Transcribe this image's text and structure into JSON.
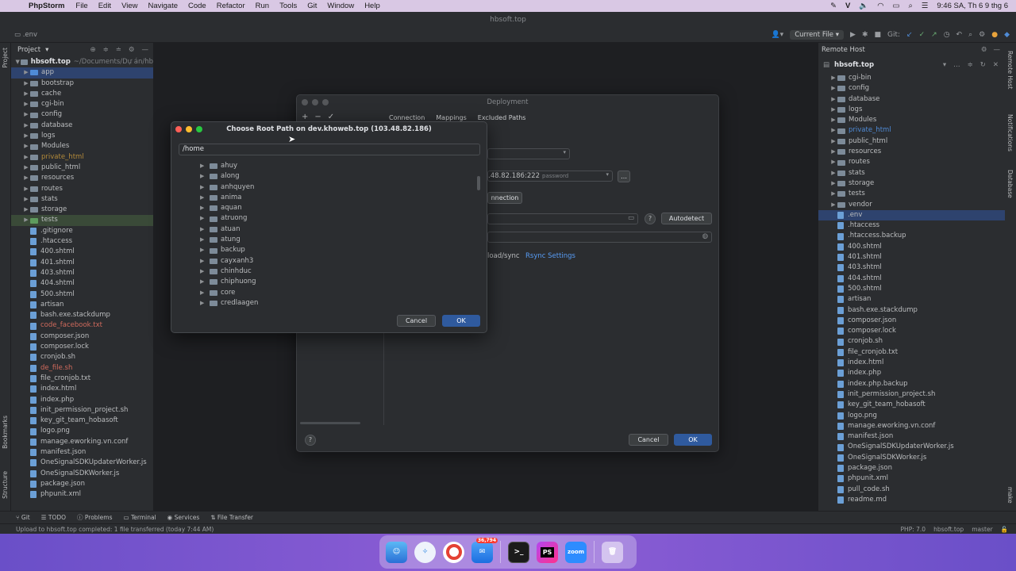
{
  "menubar": {
    "app_name": "PhpStorm",
    "items": [
      "File",
      "Edit",
      "View",
      "Navigate",
      "Code",
      "Refactor",
      "Run",
      "Tools",
      "Git",
      "Window",
      "Help"
    ],
    "clock": "9:46 SA, Th 6 9 thg 6"
  },
  "window": {
    "title": "hbsoft.top"
  },
  "toolbar": {
    "breadcrumb": ".env",
    "run_config": "Current File",
    "git_label": "Git:"
  },
  "left_stripe": {
    "project": "Project",
    "bookmarks": "Bookmarks",
    "structure": "Structure"
  },
  "project_panel": {
    "title": "Project",
    "root": "hbsoft.top",
    "root_path": "~/Documents/Dự án/hb",
    "items": [
      {
        "name": "app",
        "kind": "folder",
        "color": "blue",
        "state": "selected"
      },
      {
        "name": "bootstrap",
        "kind": "folder"
      },
      {
        "name": "cache",
        "kind": "folder"
      },
      {
        "name": "cgi-bin",
        "kind": "folder"
      },
      {
        "name": "config",
        "kind": "folder"
      },
      {
        "name": "database",
        "kind": "folder"
      },
      {
        "name": "logs",
        "kind": "folder"
      },
      {
        "name": "Modules",
        "kind": "folder"
      },
      {
        "name": "private_html",
        "kind": "folder",
        "text": "orange"
      },
      {
        "name": "public_html",
        "kind": "folder"
      },
      {
        "name": "resources",
        "kind": "folder"
      },
      {
        "name": "routes",
        "kind": "folder"
      },
      {
        "name": "stats",
        "kind": "folder"
      },
      {
        "name": "storage",
        "kind": "folder"
      },
      {
        "name": "tests",
        "kind": "folder",
        "color": "green",
        "state": "highlight"
      },
      {
        "name": ".gitignore",
        "kind": "file"
      },
      {
        "name": ".htaccess",
        "kind": "file"
      },
      {
        "name": "400.shtml",
        "kind": "file"
      },
      {
        "name": "401.shtml",
        "kind": "file"
      },
      {
        "name": "403.shtml",
        "kind": "file"
      },
      {
        "name": "404.shtml",
        "kind": "file"
      },
      {
        "name": "500.shtml",
        "kind": "file"
      },
      {
        "name": "artisan",
        "kind": "file"
      },
      {
        "name": "bash.exe.stackdump",
        "kind": "file"
      },
      {
        "name": "code_facebook.txt",
        "kind": "file",
        "text": "red"
      },
      {
        "name": "composer.json",
        "kind": "file"
      },
      {
        "name": "composer.lock",
        "kind": "file"
      },
      {
        "name": "cronjob.sh",
        "kind": "file"
      },
      {
        "name": "de_file.sh",
        "kind": "file",
        "text": "red"
      },
      {
        "name": "file_cronjob.txt",
        "kind": "file"
      },
      {
        "name": "index.html",
        "kind": "file"
      },
      {
        "name": "index.php",
        "kind": "file"
      },
      {
        "name": "init_permission_project.sh",
        "kind": "file"
      },
      {
        "name": "key_git_team_hobasoft",
        "kind": "file"
      },
      {
        "name": "logo.png",
        "kind": "file"
      },
      {
        "name": "manage.eworking.vn.conf",
        "kind": "file"
      },
      {
        "name": "manifest.json",
        "kind": "file"
      },
      {
        "name": "OneSignalSDKUpdaterWorker.js",
        "kind": "file"
      },
      {
        "name": "OneSignalSDKWorker.js",
        "kind": "file"
      },
      {
        "name": "package.json",
        "kind": "file"
      },
      {
        "name": "phpunit.xml",
        "kind": "file"
      }
    ]
  },
  "deployment_dialog": {
    "title": "Deployment",
    "tabs": [
      "Connection",
      "Mappings",
      "Excluded Paths"
    ],
    "host_field": ".48.82.186:222",
    "password_placeholder": "password",
    "test_connection": "nnection",
    "autodetect": "Autodetect",
    "upload_sync": "load/sync",
    "rsync_settings": "Rsync Settings",
    "cancel": "Cancel",
    "ok": "OK",
    "help": "?"
  },
  "choose_dialog": {
    "title": "Choose Root Path on dev.khoweb.top (103.48.82.186)",
    "path": "/home",
    "dirs": [
      "ahuy",
      "along",
      "anhquyen",
      "anima",
      "aquan",
      "atruong",
      "atuan",
      "atung",
      "backup",
      "cayxanh3",
      "chinhduc",
      "chiphuong",
      "core",
      "credlaagen"
    ],
    "cancel": "Cancel",
    "ok": "OK"
  },
  "remote_panel": {
    "title": "Remote Host",
    "host": "hbsoft.top",
    "items": [
      {
        "name": "cgi-bin",
        "kind": "folder"
      },
      {
        "name": "config",
        "kind": "folder"
      },
      {
        "name": "database",
        "kind": "folder"
      },
      {
        "name": "logs",
        "kind": "folder"
      },
      {
        "name": "Modules",
        "kind": "folder"
      },
      {
        "name": "private_html",
        "kind": "folder",
        "text": "blue"
      },
      {
        "name": "public_html",
        "kind": "folder"
      },
      {
        "name": "resources",
        "kind": "folder"
      },
      {
        "name": "routes",
        "kind": "folder"
      },
      {
        "name": "stats",
        "kind": "folder"
      },
      {
        "name": "storage",
        "kind": "folder"
      },
      {
        "name": "tests",
        "kind": "folder"
      },
      {
        "name": "vendor",
        "kind": "folder"
      },
      {
        "name": ".env",
        "kind": "file",
        "state": "selected"
      },
      {
        "name": ".htaccess",
        "kind": "file"
      },
      {
        "name": ".htaccess.backup",
        "kind": "file"
      },
      {
        "name": "400.shtml",
        "kind": "file"
      },
      {
        "name": "401.shtml",
        "kind": "file"
      },
      {
        "name": "403.shtml",
        "kind": "file"
      },
      {
        "name": "404.shtml",
        "kind": "file"
      },
      {
        "name": "500.shtml",
        "kind": "file"
      },
      {
        "name": "artisan",
        "kind": "file"
      },
      {
        "name": "bash.exe.stackdump",
        "kind": "file"
      },
      {
        "name": "composer.json",
        "kind": "file"
      },
      {
        "name": "composer.lock",
        "kind": "file"
      },
      {
        "name": "cronjob.sh",
        "kind": "file"
      },
      {
        "name": "file_cronjob.txt",
        "kind": "file"
      },
      {
        "name": "index.html",
        "kind": "file"
      },
      {
        "name": "index.php",
        "kind": "file"
      },
      {
        "name": "index.php.backup",
        "kind": "file"
      },
      {
        "name": "init_permission_project.sh",
        "kind": "file"
      },
      {
        "name": "key_git_team_hobasoft",
        "kind": "file"
      },
      {
        "name": "logo.png",
        "kind": "file"
      },
      {
        "name": "manage.eworking.vn.conf",
        "kind": "file"
      },
      {
        "name": "manifest.json",
        "kind": "file"
      },
      {
        "name": "OneSignalSDKUpdaterWorker.js",
        "kind": "file"
      },
      {
        "name": "OneSignalSDKWorker.js",
        "kind": "file"
      },
      {
        "name": "package.json",
        "kind": "file"
      },
      {
        "name": "phpunit.xml",
        "kind": "file"
      },
      {
        "name": "pull_code.sh",
        "kind": "file"
      },
      {
        "name": "readme.md",
        "kind": "file"
      }
    ]
  },
  "right_stripe": {
    "remote_host": "Remote Host",
    "notifications": "Notifications",
    "database": "Database",
    "make": "make"
  },
  "bottom_tools": [
    "Git",
    "TODO",
    "Problems",
    "Terminal",
    "Services",
    "File Transfer"
  ],
  "status": {
    "message": "Upload to hbsoft.top completed: 1 file transferred (today 7:44 AM)",
    "php": "PHP: 7.0",
    "host": "hbsoft.top",
    "branch": "master"
  },
  "dock": {
    "mail_badge": "36,794",
    "zoom": "zoom",
    "phpstorm": "PS"
  }
}
